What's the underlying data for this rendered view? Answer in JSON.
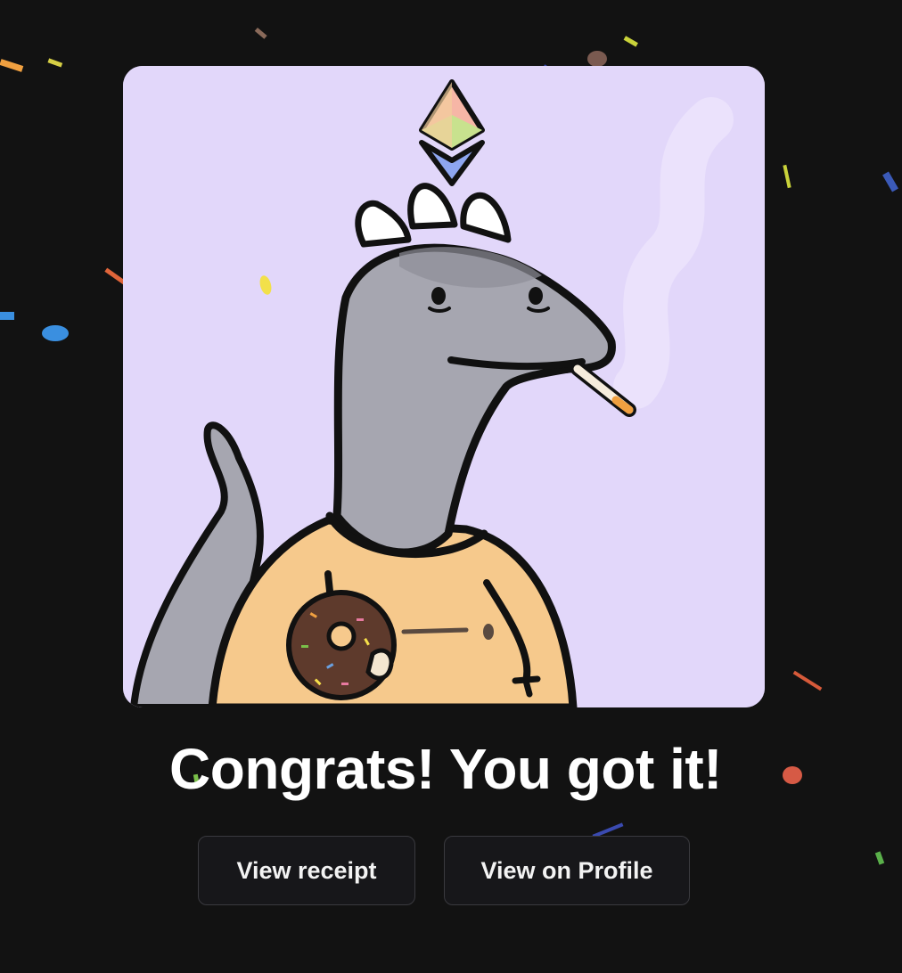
{
  "dialog": {
    "headline": "Congrats! You got it!"
  },
  "actions": {
    "view_receipt_label": "View receipt",
    "view_profile_label": "View on Profile"
  },
  "nft": {
    "subject": "cartoon grey dinosaur with cigarette and donut",
    "badge_icon": "ethereum-icon"
  },
  "colors": {
    "page_background": "#121212",
    "card_background": "#e2d7fa",
    "button_background": "#17171a",
    "button_border": "#3a3a3f",
    "text": "#ffffff"
  }
}
